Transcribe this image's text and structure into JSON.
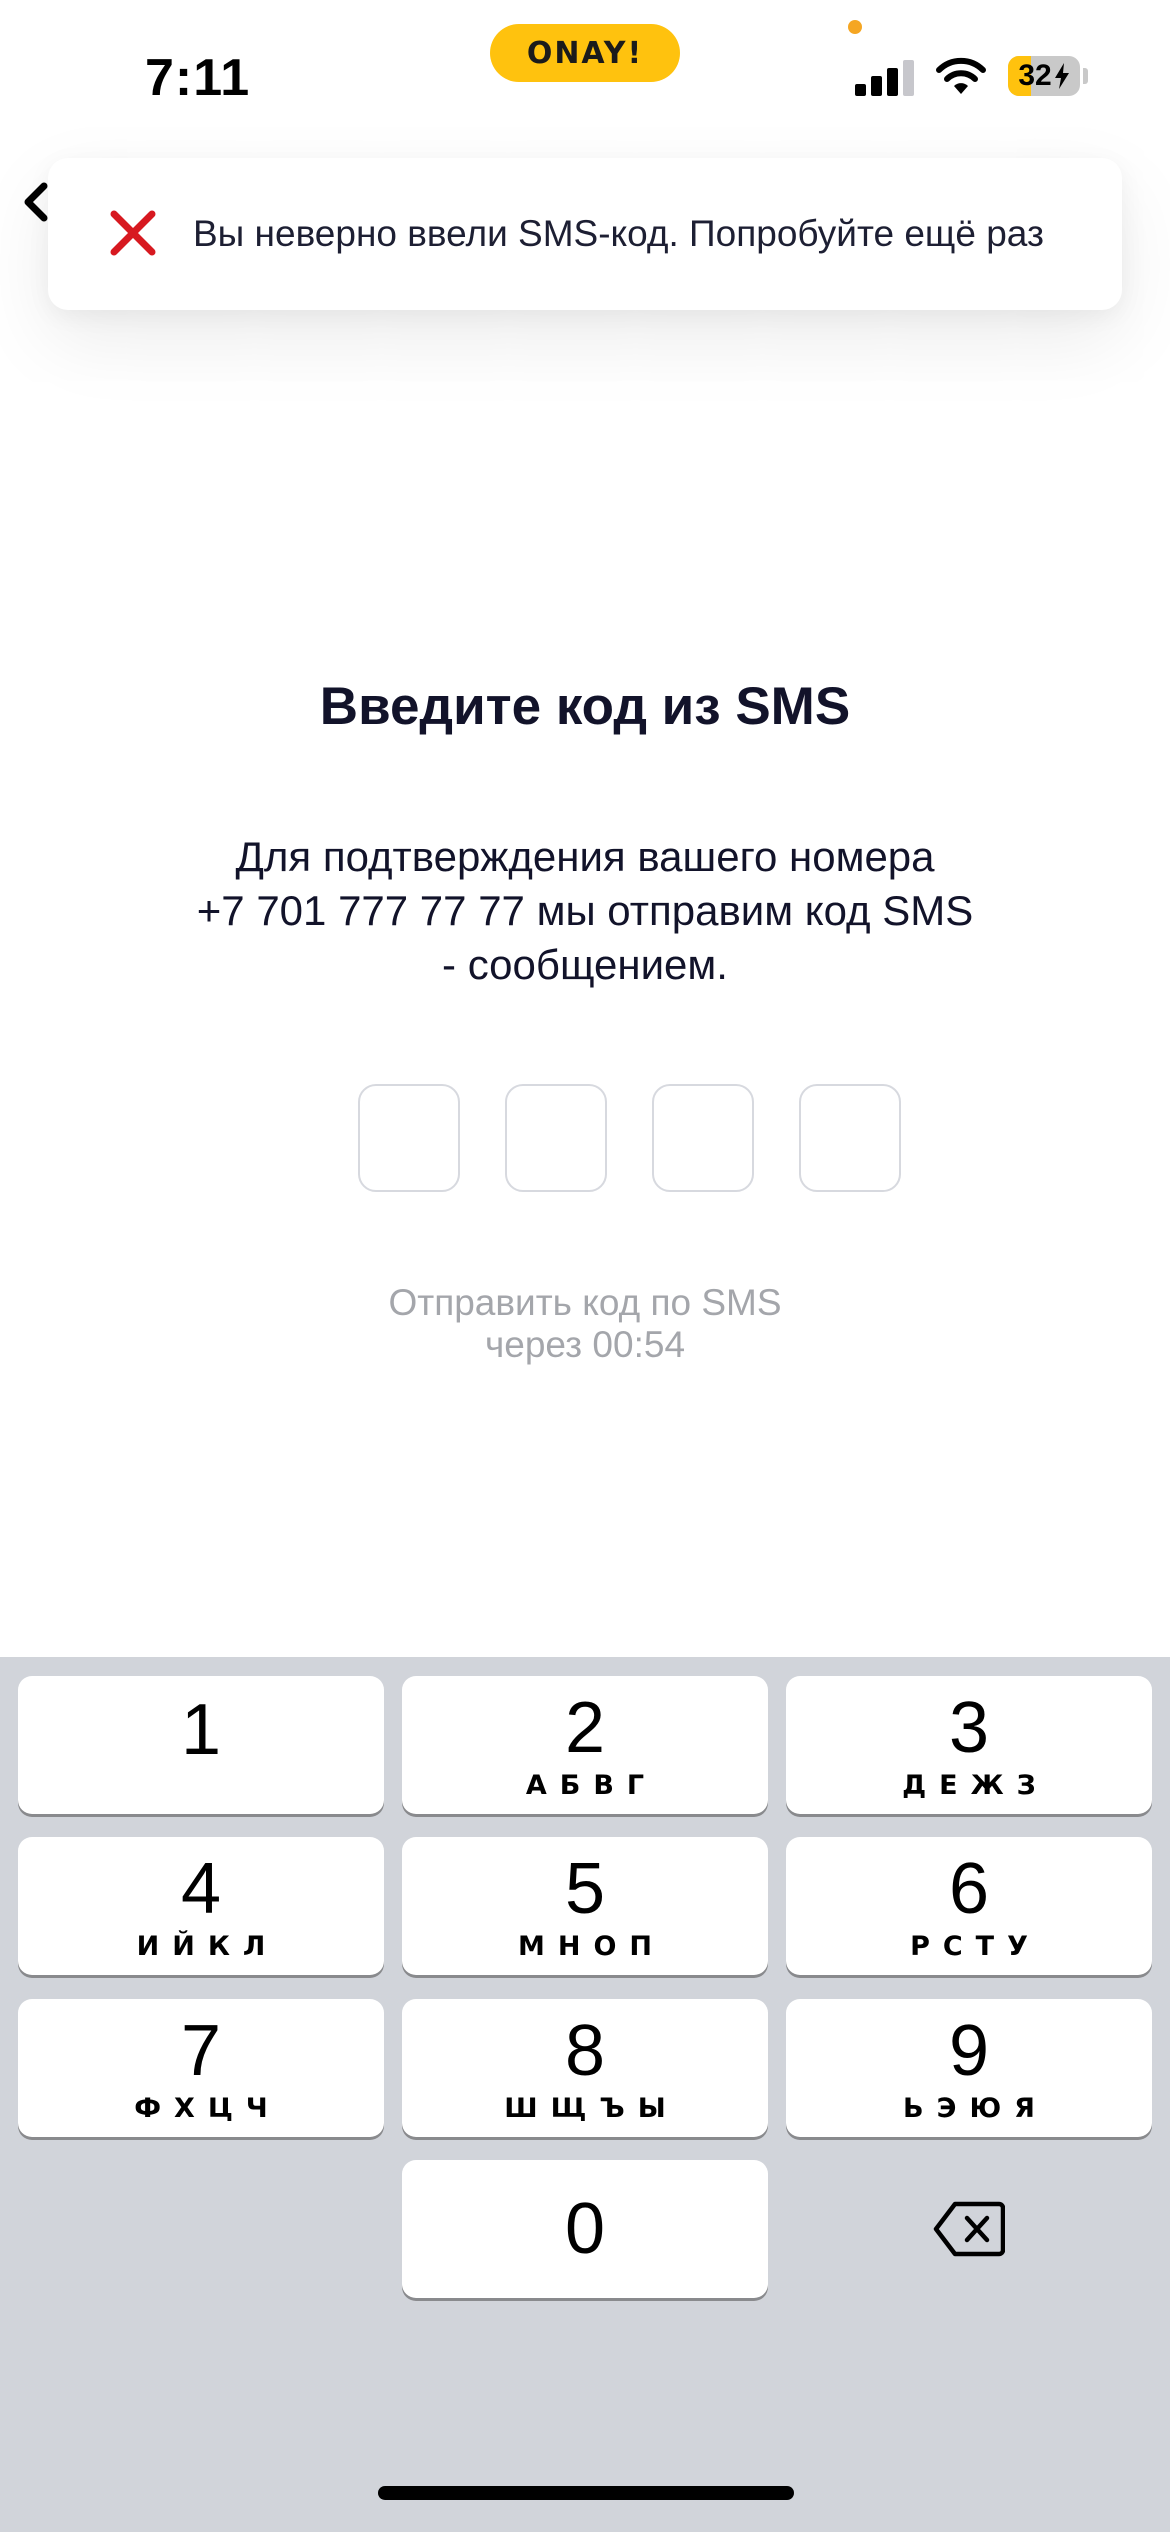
{
  "status_bar": {
    "time": "7:11",
    "island_label": "ONAY!",
    "battery_text": "32",
    "battery_level_percent": 32,
    "accent_color": "#ffc20e"
  },
  "toast": {
    "icon": "close-icon",
    "icon_color": "#d71920",
    "message": "Вы неверно ввели SMS-код. Попробуйте ещё раз"
  },
  "main": {
    "title": "Введите код из SMS",
    "description_lines": [
      "Для подтверждения вашего номера",
      "+7 701 777 77 77 мы отправим код SMS",
      "- сообщением."
    ],
    "code_length": 4,
    "resend_line1": "Отправить код по SMS",
    "resend_line2": "через 00:54"
  },
  "keyboard": {
    "keys": [
      {
        "digit": "1",
        "letters": ""
      },
      {
        "digit": "2",
        "letters": "АБВГ"
      },
      {
        "digit": "3",
        "letters": "ДЕЖЗ"
      },
      {
        "digit": "4",
        "letters": "ИЙКЛ"
      },
      {
        "digit": "5",
        "letters": "МНОП"
      },
      {
        "digit": "6",
        "letters": "РСТУ"
      },
      {
        "digit": "7",
        "letters": "ФХЦЧ"
      },
      {
        "digit": "8",
        "letters": "ШЩЪЫ"
      },
      {
        "digit": "9",
        "letters": "ЬЭЮЯ"
      },
      {
        "digit": "0",
        "letters": ""
      }
    ],
    "backspace_icon": "backspace-icon"
  }
}
